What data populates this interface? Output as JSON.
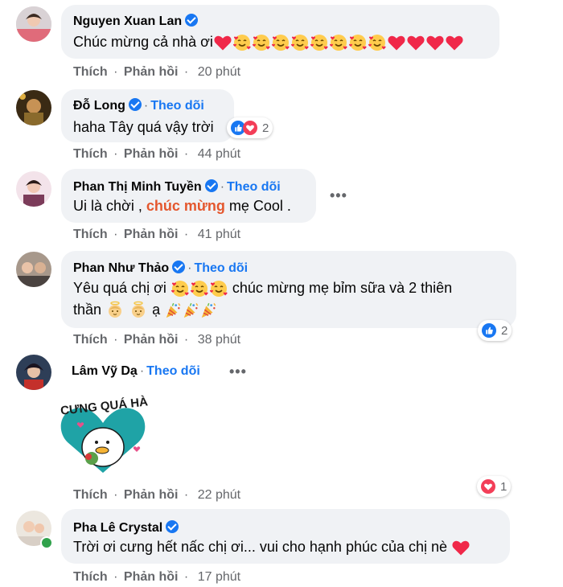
{
  "comments": [
    {
      "name": "Nguyen Xuan Lan",
      "text": "Chúc mừng cả nhà ơi",
      "time": "20 phút"
    },
    {
      "name": "Đỗ Long",
      "follow": "Theo dõi",
      "text": "haha Tây quá vậy trời",
      "time": "44 phút",
      "reaction_count": "2"
    },
    {
      "name": "Phan Thị Minh Tuyền",
      "follow": "Theo dõi",
      "text_a": "Ui là chời ,",
      "text_highlight": "chúc mừng",
      "text_b": "mẹ Cool .",
      "time": "41 phút"
    },
    {
      "name": "Phan Như Thảo",
      "follow": "Theo dõi",
      "text_line1_a": "Yêu quá chị ơi",
      "text_line1_b": "chúc mừng mẹ bỉm sữa và 2 thiên",
      "text_line2_a": "thần",
      "text_line2_b": "ạ",
      "time": "38 phút",
      "reaction_count": "2"
    },
    {
      "name": "Lâm Vỹ Dạ",
      "follow": "Theo dõi",
      "sticker_text": "CƯNG QUÁ HÀ",
      "time": "22 phút",
      "reaction_count": "1"
    },
    {
      "name": "Pha Lê Crystal",
      "text": "Trời ơi cưng hết nấc chị ơi... vui cho hạnh phúc của chị nè",
      "time": "17 phút"
    }
  ],
  "labels": {
    "like": "Thích",
    "reply": "Phản hồi",
    "dot": "·",
    "more": "•••"
  },
  "icons": {
    "verified": "verified-badge-icon",
    "heart": "heart-icon",
    "heart_face": "smiling-face-with-hearts-icon",
    "like": "like-icon",
    "baby": "baby-angel-icon",
    "party": "party-popper-icon"
  },
  "colors": {
    "bubble": "#f0f2f5",
    "accent": "#1877f2",
    "muted": "#65676b",
    "heart": "#f02849",
    "highlight": "#e4572e"
  }
}
